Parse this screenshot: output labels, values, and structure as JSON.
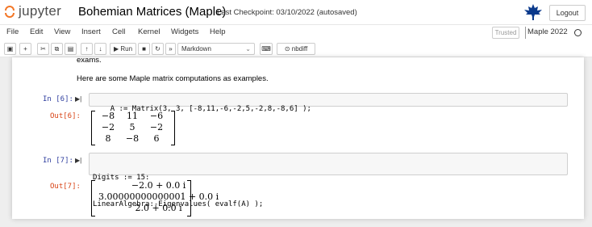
{
  "header": {
    "logo_text": "jupyter",
    "notebook_title": "Bohemian Matrices (Maple)",
    "checkpoint": "Last Checkpoint: 03/10/2022  (autosaved)",
    "logout_label": "Logout",
    "maple_icon": "maple-leaf-icon"
  },
  "menu": {
    "items": [
      "File",
      "Edit",
      "View",
      "Insert",
      "Cell",
      "Kernel",
      "Widgets",
      "Help"
    ],
    "trusted": "Trusted",
    "kernel": "Maple 2022"
  },
  "toolbar": {
    "run_label": "Run",
    "cell_type": "Markdown",
    "nbdiff_label": "nbdiff",
    "icons": [
      "save-icon",
      "add-cell-icon",
      "cut-icon",
      "copy-icon",
      "paste-icon",
      "move-up-icon",
      "move-down-icon",
      "run-icon",
      "stop-icon",
      "restart-icon",
      "fast-forward-icon",
      "keyboard-icon",
      "nbdiff-icon"
    ],
    "accent": "#f37626"
  },
  "cells": {
    "markdown": {
      "partial_line": "exams.",
      "line": "Here are some Maple matrix computations as examples."
    },
    "cell6": {
      "in_prompt": "In [6]:",
      "code": "A := Matrix(3, 3, [-8,11,-6,-2,5,-2,8,-8,6] );",
      "out_prompt": "Out[6]:",
      "matrix": [
        [
          "−8",
          "11",
          "−6"
        ],
        [
          "−2",
          "5",
          "−2"
        ],
        [
          "8",
          "−8",
          "6"
        ]
      ]
    },
    "cell7": {
      "in_prompt": "In [7]:",
      "code_line1": "Digits := 15:",
      "code_line2": "LinearAlgebra:-Eigenvalues( evalf(A) );",
      "out_prompt": "Out[7]:",
      "vector": [
        "−2.0 + 0.0 i",
        "3.00000000000001 + 0.0 i",
        "2.0 + 0.0 i"
      ]
    }
  },
  "colors": {
    "in_prompt": "#303f9f",
    "out_prompt": "#d84315",
    "background": "#eeeeee"
  }
}
